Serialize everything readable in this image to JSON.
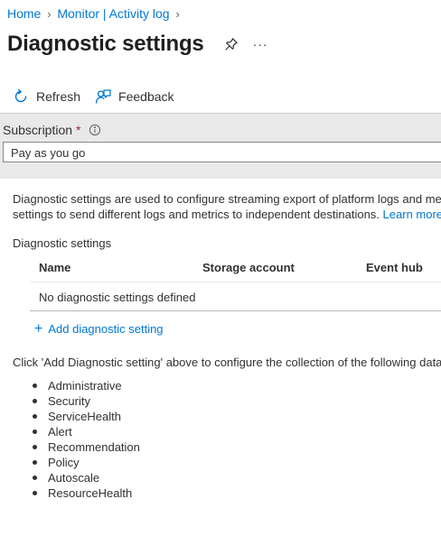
{
  "breadcrumb": [
    {
      "label": "Home"
    },
    {
      "label": "Monitor | Activity log"
    }
  ],
  "page": {
    "title": "Diagnostic settings",
    "pin_icon": "pin-icon",
    "more_label": "···"
  },
  "toolbar": {
    "refresh_label": "Refresh",
    "feedback_label": "Feedback"
  },
  "subscription": {
    "label": "Subscription",
    "required_mark": "*",
    "value": "Pay as you go"
  },
  "description": {
    "line1": "Diagnostic settings are used to configure streaming export of platform logs and metrics for a resource to the destination of your choice. You may create up to five diagnostic",
    "line2": "settings to send different logs and metrics to independent destinations.",
    "learn_more": "Learn more"
  },
  "settings_section": {
    "label": "Diagnostic settings",
    "columns": [
      "Name",
      "Storage account",
      "Event hub"
    ],
    "empty_text": "No diagnostic settings defined",
    "add_label": "Add diagnostic setting"
  },
  "categories": {
    "intro": "Click 'Add Diagnostic setting' above to configure the collection of the following data",
    "items": [
      "Administrative",
      "Security",
      "ServiceHealth",
      "Alert",
      "Recommendation",
      "Policy",
      "Autoscale",
      "ResourceHealth"
    ]
  },
  "colors": {
    "link": "#0078d4",
    "band": "#e9e9e9",
    "required": "#a4262c"
  }
}
